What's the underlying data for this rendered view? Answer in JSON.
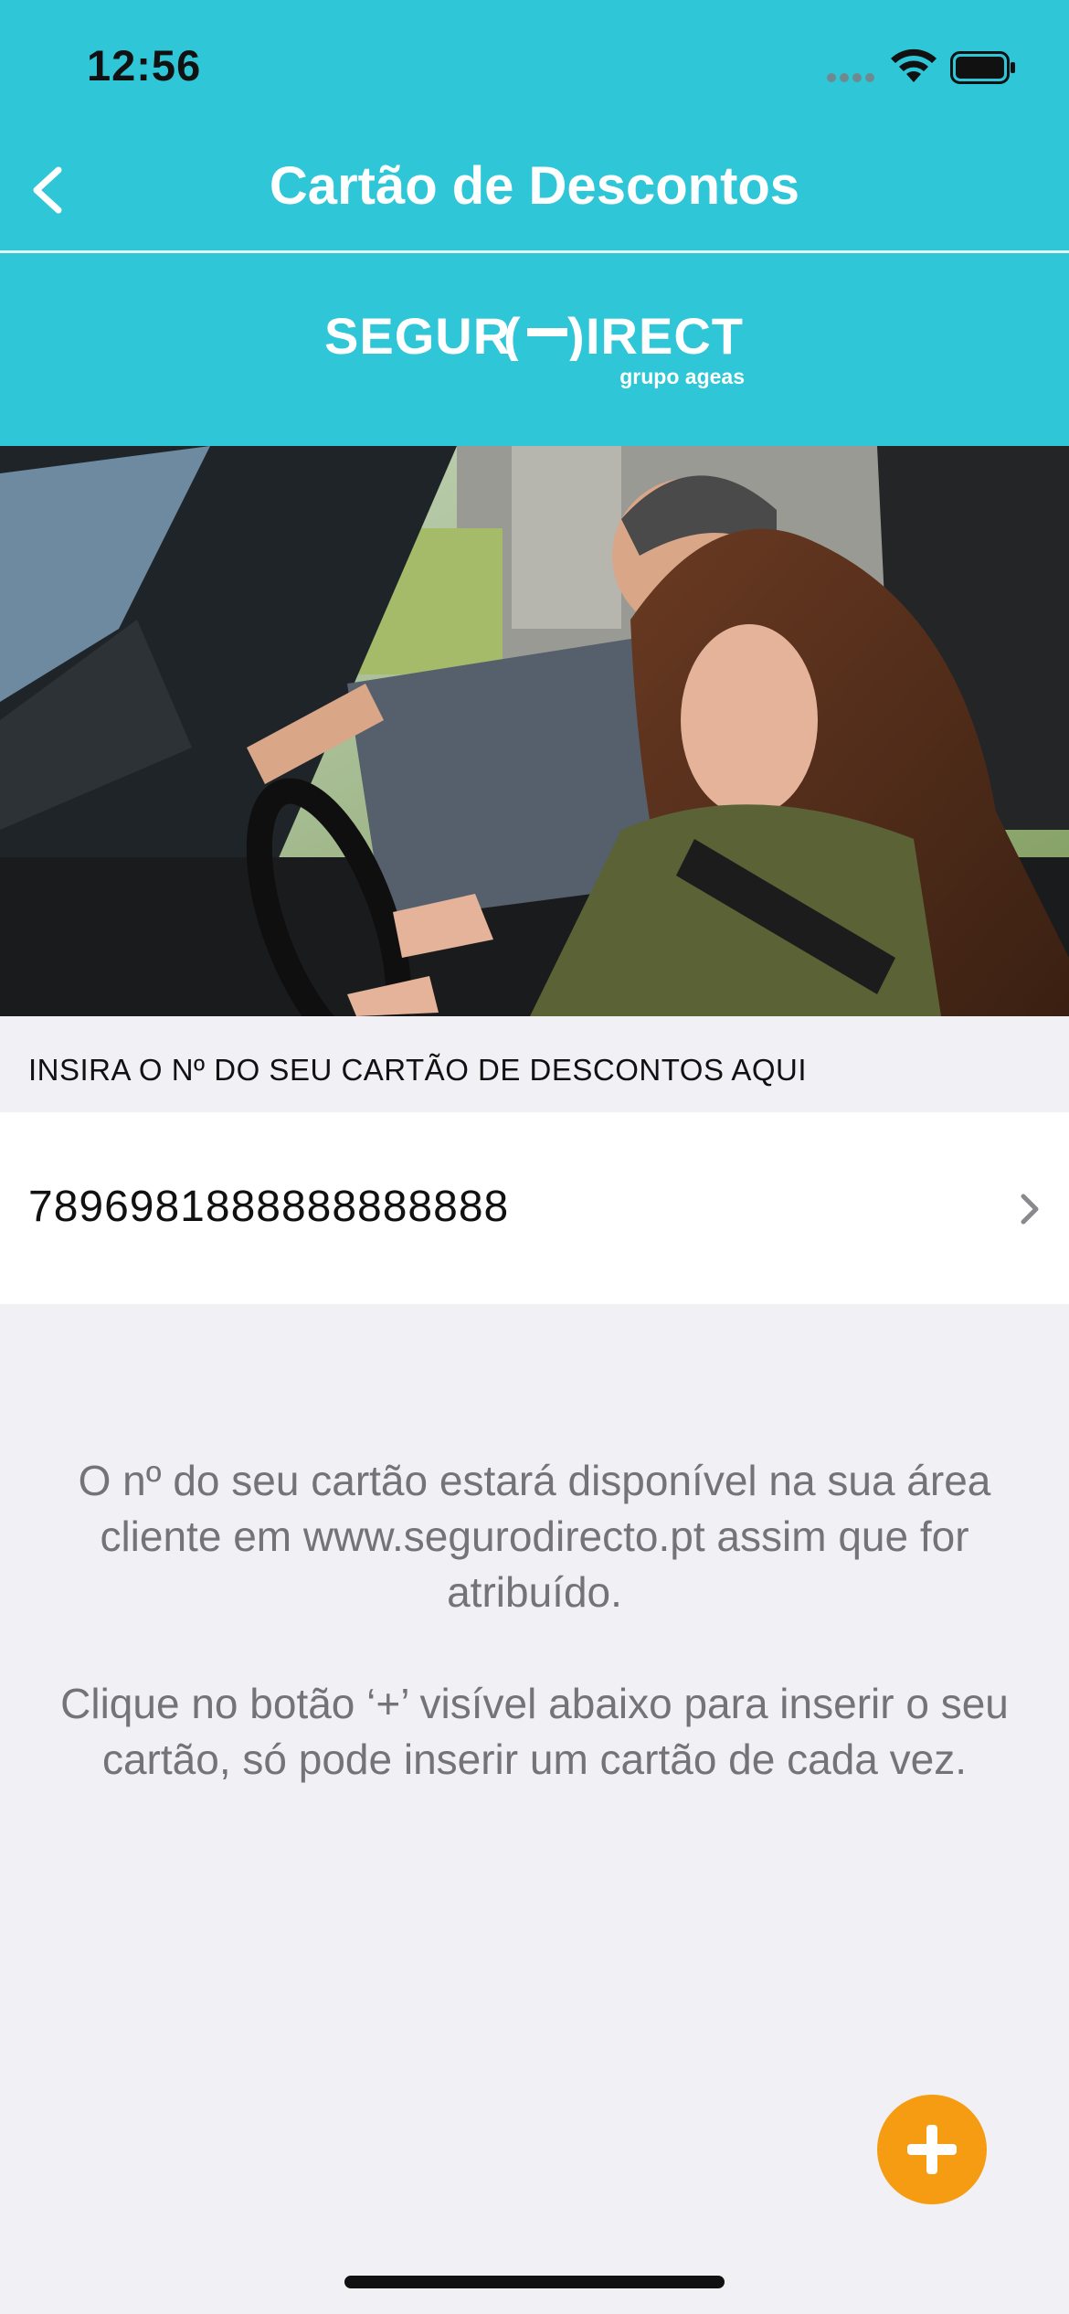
{
  "status_bar": {
    "time": "12:56"
  },
  "nav": {
    "title": "Cartão de Descontos",
    "back_icon": "chevron-left-icon"
  },
  "brand": {
    "logo_text": "SEGURO DIRECTO",
    "subtitle": "grupo ageas"
  },
  "hero_image": {
    "description_icon": "photo"
  },
  "card_section": {
    "header": "INSIRA O Nº DO SEU CARTÃO DE DESCONTOS AQUI",
    "card_number": "7896981888888888888",
    "chevron_icon": "chevron-right-icon"
  },
  "info": {
    "paragraph1": "O nº do seu cartão estará disponível na sua área cliente em www.segurodirecto.pt assim que for atribuído.",
    "paragraph2": "Clique no botão ‘+’ visível abaixo para inserir o seu cartão, só pode inserir um cartão de cada vez."
  },
  "fab": {
    "icon": "plus-icon"
  },
  "colors": {
    "header_bg": "#2fc6d8",
    "page_bg": "#f1f0f5",
    "fab_bg": "#f59c12",
    "info_text": "#737378"
  }
}
